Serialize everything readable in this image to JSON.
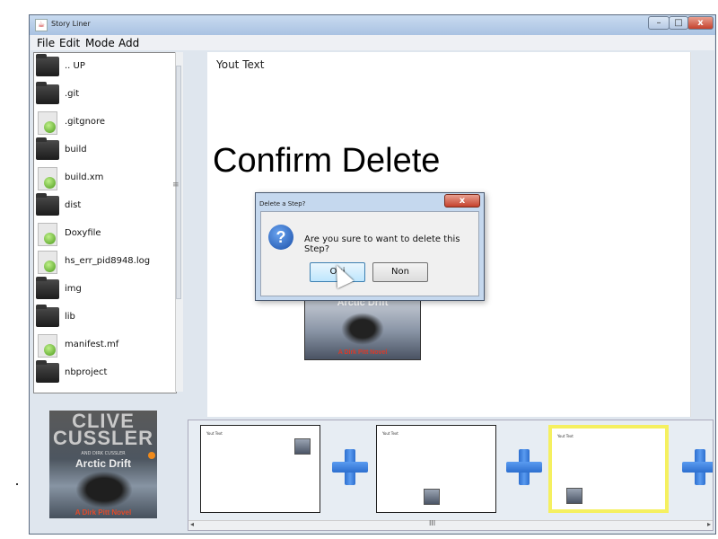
{
  "window": {
    "title": "Story Liner",
    "app_icon": "java-icon",
    "minimize": "–",
    "maximize": "□",
    "close": "x"
  },
  "menu": [
    "File",
    "Edit",
    "Mode",
    "Add"
  ],
  "files": [
    {
      "name": ".. UP",
      "type": "folder"
    },
    {
      "name": ".git",
      "type": "folder"
    },
    {
      "name": ".gitgnore",
      "type": "file"
    },
    {
      "name": "build",
      "type": "folder"
    },
    {
      "name": "build.xm",
      "type": "file"
    },
    {
      "name": "dist",
      "type": "folder"
    },
    {
      "name": "Doxyfile",
      "type": "file"
    },
    {
      "name": "hs_err_pid8948.log",
      "type": "file"
    },
    {
      "name": "img",
      "type": "folder"
    },
    {
      "name": "lib",
      "type": "folder"
    },
    {
      "name": "manifest.mf",
      "type": "file"
    },
    {
      "name": "nbproject",
      "type": "folder"
    }
  ],
  "editor": {
    "your_text": "Yout Text",
    "title": "Confirm Delete",
    "image_title": "Arctic Drift",
    "image_footer": "A Dirk Pitt Novel"
  },
  "cover": {
    "author": "CLIVE CUSSLER",
    "subtitle": "AND DIRK CUSSLER",
    "title": "Arctic Drift",
    "footer": "A Dirk Pitt Novel"
  },
  "dialog": {
    "title": "Delete a Step?",
    "close": "x",
    "icon": "question-icon",
    "message": "Are you sure to want to delete this Step?",
    "ok_label": "Oui",
    "no_label": "Non"
  },
  "timeline": {
    "thumb_text": "Yout Text",
    "scroll_grip": "III",
    "scroll_left": "◂",
    "scroll_right": "▸"
  },
  "splitter_grip": "≡",
  "colors": {
    "selected_border": "#f5f060",
    "plus": "#2d6fcf",
    "titlebar": "#b8cde8"
  }
}
